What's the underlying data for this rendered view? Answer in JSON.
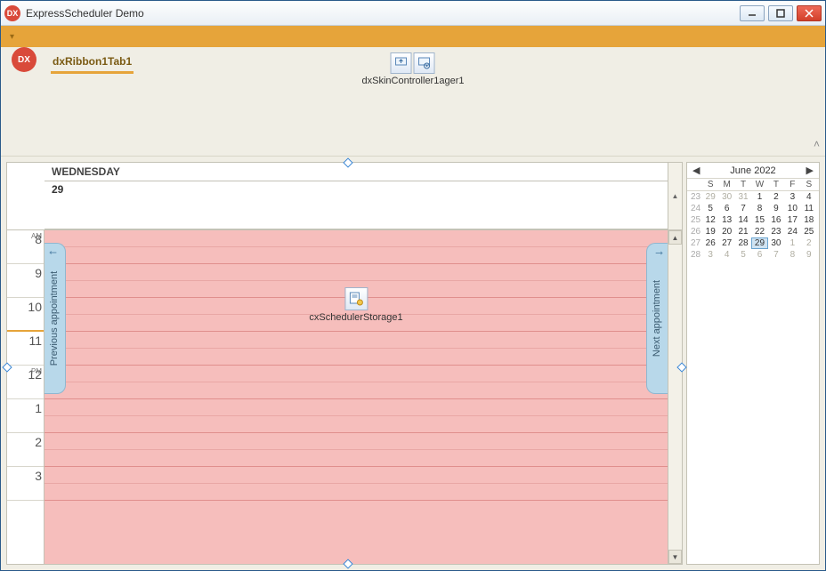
{
  "window": {
    "title": "ExpressScheduler Demo",
    "app_icon_text": "DX"
  },
  "ribbon": {
    "app_button_text": "DX",
    "tab_label": "dxRibbon1Tab1",
    "skin_controller_label": "dxSkinController1ager1"
  },
  "scheduler": {
    "day_header": "WEDNESDAY",
    "date_label": "29",
    "prev_appointment_label": "Previous appointment",
    "next_appointment_label": "Next appointment",
    "storage_label": "cxSchedulerStorage1",
    "time_slots": [
      {
        "hour": "8",
        "ampm": "AM"
      },
      {
        "hour": "9",
        "ampm": ""
      },
      {
        "hour": "10",
        "ampm": ""
      },
      {
        "hour": "11",
        "ampm": ""
      },
      {
        "hour": "12",
        "ampm": "PM"
      },
      {
        "hour": "1",
        "ampm": ""
      },
      {
        "hour": "2",
        "ampm": ""
      },
      {
        "hour": "3",
        "ampm": ""
      }
    ]
  },
  "date_navigator": {
    "title": "June 2022",
    "dow": [
      "S",
      "M",
      "T",
      "W",
      "T",
      "F",
      "S"
    ],
    "weeks": [
      {
        "wk": "23",
        "days": [
          {
            "d": "29",
            "o": true
          },
          {
            "d": "30",
            "o": true
          },
          {
            "d": "31",
            "o": true
          },
          {
            "d": "1"
          },
          {
            "d": "2"
          },
          {
            "d": "3"
          },
          {
            "d": "4"
          }
        ]
      },
      {
        "wk": "24",
        "days": [
          {
            "d": "5"
          },
          {
            "d": "6"
          },
          {
            "d": "7"
          },
          {
            "d": "8"
          },
          {
            "d": "9"
          },
          {
            "d": "10"
          },
          {
            "d": "11"
          }
        ]
      },
      {
        "wk": "25",
        "days": [
          {
            "d": "12"
          },
          {
            "d": "13"
          },
          {
            "d": "14"
          },
          {
            "d": "15"
          },
          {
            "d": "16"
          },
          {
            "d": "17"
          },
          {
            "d": "18"
          }
        ]
      },
      {
        "wk": "26",
        "days": [
          {
            "d": "19"
          },
          {
            "d": "20"
          },
          {
            "d": "21"
          },
          {
            "d": "22"
          },
          {
            "d": "23"
          },
          {
            "d": "24"
          },
          {
            "d": "25"
          }
        ]
      },
      {
        "wk": "27",
        "days": [
          {
            "d": "26"
          },
          {
            "d": "27"
          },
          {
            "d": "28"
          },
          {
            "d": "29",
            "sel": true
          },
          {
            "d": "30"
          },
          {
            "d": "1",
            "o": true
          },
          {
            "d": "2",
            "o": true
          }
        ]
      },
      {
        "wk": "28",
        "days": [
          {
            "d": "3",
            "o": true
          },
          {
            "d": "4",
            "o": true
          },
          {
            "d": "5",
            "o": true
          },
          {
            "d": "6",
            "o": true
          },
          {
            "d": "7",
            "o": true
          },
          {
            "d": "8",
            "o": true
          },
          {
            "d": "9",
            "o": true
          }
        ]
      }
    ]
  }
}
